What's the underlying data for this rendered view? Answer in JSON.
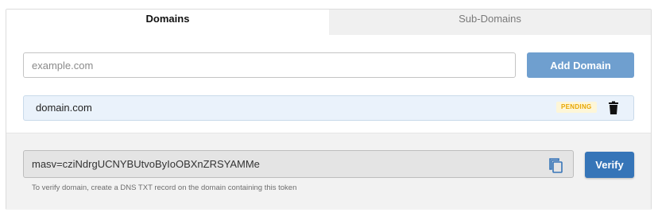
{
  "tabs": {
    "domains_label": "Domains",
    "subdomains_label": "Sub-Domains"
  },
  "add_domain": {
    "placeholder": "example.com",
    "value": "",
    "button_label": "Add Domain"
  },
  "domains": [
    {
      "name": "domain.com",
      "status": "PENDING"
    }
  ],
  "verification": {
    "token": "masv=cziNdrgUCNYBUtvoByIoOBXnZRSYAMMe",
    "helper_text": "To verify domain, create a DNS TXT record on the domain containing this token",
    "verify_label": "Verify"
  },
  "icons": {
    "delete": "trash-icon",
    "copy": "copy-icon"
  },
  "colors": {
    "primary": "#3675b8",
    "primary_disabled": "#6f9fcf",
    "pending_text": "#e8a600",
    "pending_bg": "#fdf6d8",
    "row_bg": "#eaf2fb"
  }
}
